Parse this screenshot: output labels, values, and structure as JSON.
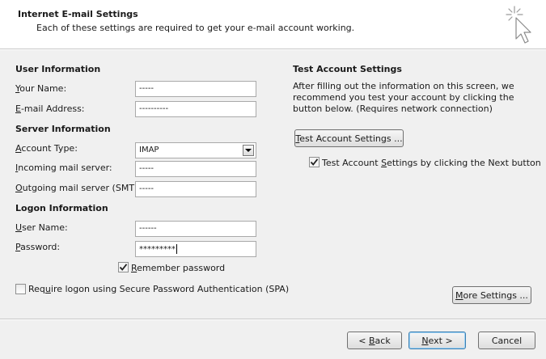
{
  "header": {
    "title": "Internet E-mail Settings",
    "subtitle": "Each of these settings are required to get your e-mail account working."
  },
  "user_info": {
    "title": "User Information",
    "name_label": "Your Name:",
    "name_value": "-----",
    "email_label": "E-mail Address:",
    "email_value": "----------"
  },
  "server_info": {
    "title": "Server Information",
    "account_type_label": "Account Type:",
    "account_type_value": "IMAP",
    "incoming_label": "Incoming mail server:",
    "incoming_value": "-----",
    "outgoing_label": "Outgoing mail server (SMTP):",
    "outgoing_value": "-----"
  },
  "logon_info": {
    "title": "Logon Information",
    "username_label": "User Name:",
    "username_value": "------",
    "password_label": "Password:",
    "password_value": "*********",
    "remember_label": "Remember password",
    "remember_checked": true,
    "spa_label": "Require logon using Secure Password Authentication (SPA)",
    "spa_checked": false
  },
  "test_settings": {
    "title": "Test Account Settings",
    "description": "After filling out the information on this screen, we recommend you test your account by clicking the button below. (Requires network connection)",
    "test_button": "Test Account Settings ...",
    "auto_test_label": "Test Account Settings by clicking the Next button",
    "auto_test_checked": true
  },
  "buttons": {
    "more_settings": "More Settings ...",
    "back": "< Back",
    "next": "Next >",
    "cancel": "Cancel"
  },
  "icons": {
    "wizard": "wizard-cursor-sparkle-icon",
    "check": "checkmark-icon",
    "dropdown": "dropdown-arrow-icon"
  },
  "colors": {
    "header_bg": "#ffffff",
    "body_bg": "#f0f0f0",
    "default_button_border": "#3c7fb1"
  }
}
